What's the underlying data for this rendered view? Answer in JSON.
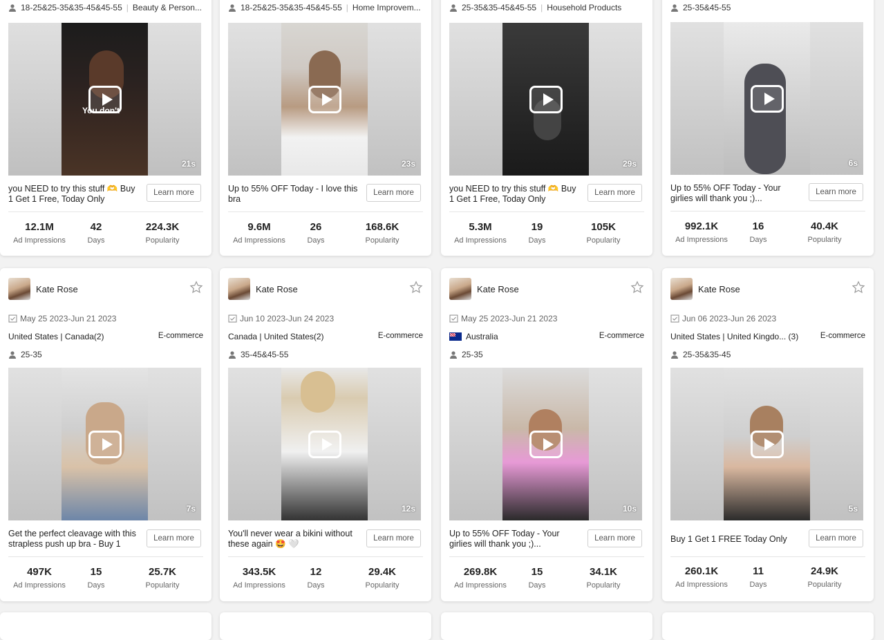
{
  "learn_more_label": "Learn more",
  "stat_labels": {
    "impressions": "Ad Impressions",
    "days": "Days",
    "popularity": "Popularity"
  },
  "icons": {
    "audience": "user-icon",
    "date": "calendar-icon",
    "favorite": "star-icon",
    "play": "play-icon"
  },
  "colors": {
    "card_bg": "#ffffff",
    "page_bg": "#f2f2f2",
    "text": "#222222",
    "muted": "#666666"
  },
  "row0": [
    {
      "audience": "18-25&25-35&35-45&45-55",
      "category": "Beauty & Person...",
      "duration": "21s",
      "description": "you NEED to try this stuff 🫶 Buy 1 Get 1 Free, Today Only",
      "impressions": "12.1M",
      "days": "42",
      "popularity": "224.3K",
      "overlay": "You don't"
    },
    {
      "audience": "18-25&25-35&35-45&45-55",
      "category": "Home Improvem...",
      "duration": "23s",
      "description": "Up to 55% OFF Today - I love this bra",
      "impressions": "9.6M",
      "days": "26",
      "popularity": "168.6K"
    },
    {
      "audience": "25-35&35-45&45-55",
      "category": "Household Products",
      "duration": "29s",
      "description": "you NEED to try this stuff 🫶 Buy 1 Get 1 Free, Today Only",
      "impressions": "5.3M",
      "days": "19",
      "popularity": "105K"
    },
    {
      "audience": "25-35&45-55",
      "category": "",
      "duration": "6s",
      "description": "Up to 55% OFF Today - Your girlies will thank you ;)...",
      "impressions": "992.1K",
      "days": "16",
      "popularity": "40.4K"
    }
  ],
  "row1": [
    {
      "creator": "Kate  Rose",
      "date": "May 25 2023-Jun 21 2023",
      "geo": "United States | Canada(2)",
      "category": "E-commerce",
      "audience": "25-35",
      "duration": "7s",
      "description": "Get the perfect cleavage with this strapless push up bra - Buy 1 Ge...",
      "impressions": "497K",
      "days": "15",
      "popularity": "25.7K"
    },
    {
      "creator": "Kate  Rose",
      "date": "Jun 10 2023-Jun 24 2023",
      "geo": "Canada | United States(2)",
      "category": "E-commerce",
      "audience": "35-45&45-55",
      "duration": "12s",
      "description": "You'll never wear a bikini without these again 🤩 🤍",
      "impressions": "343.5K",
      "days": "12",
      "popularity": "29.4K"
    },
    {
      "creator": "Kate  Rose",
      "date": "May 25 2023-Jun 21 2023",
      "geo": "Australia",
      "category": "E-commerce",
      "audience": "25-35",
      "duration": "10s",
      "description": "Up to 55% OFF Today - Your girlies will thank you ;)...",
      "impressions": "269.8K",
      "days": "15",
      "popularity": "34.1K"
    },
    {
      "creator": "Kate  Rose",
      "date": "Jun 06 2023-Jun 26 2023",
      "geo": "United States | United Kingdo...  (3)",
      "category": "E-commerce",
      "audience": "25-35&35-45",
      "duration": "5s",
      "description": "Buy 1 Get 1 FREE Today Only",
      "impressions": "260.1K",
      "days": "11",
      "popularity": "24.9K"
    }
  ]
}
